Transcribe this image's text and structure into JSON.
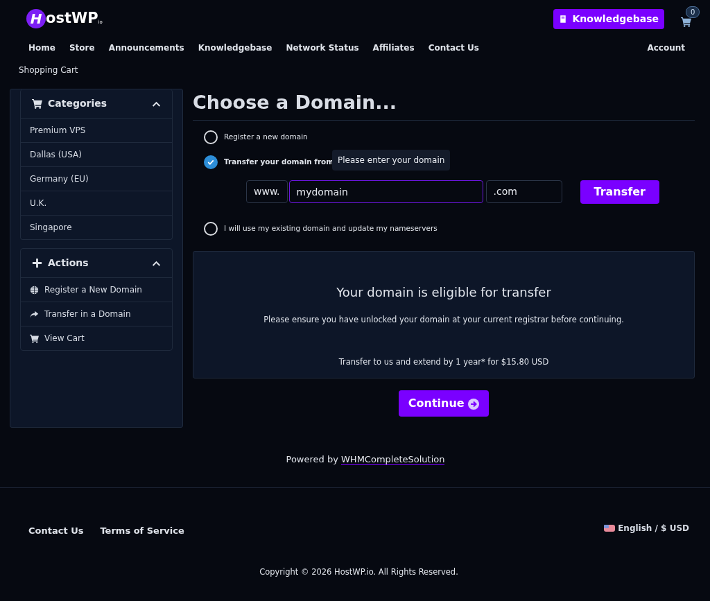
{
  "header": {
    "logo": {
      "mark": "H",
      "name": "ostWP",
      "suffix": "io"
    },
    "kb_button": "Knowledgebase",
    "cart_count": "0"
  },
  "nav": {
    "items": [
      "Home",
      "Store",
      "Announcements",
      "Knowledgebase",
      "Network Status",
      "Affiliates",
      "Contact Us"
    ],
    "account": "Account"
  },
  "breadcrumb": "Shopping Cart",
  "sidebar": [
    {
      "title": "Categories",
      "expanded": true,
      "items": [
        {
          "label": "Premium VPS"
        },
        {
          "label": "Dallas (USA)"
        },
        {
          "label": "Germany (EU)"
        },
        {
          "label": "U.K."
        },
        {
          "label": "Singapore"
        }
      ]
    },
    {
      "title": "Actions",
      "expanded": true,
      "items": [
        {
          "label": "Register a New Domain"
        },
        {
          "label": "Transfer in a Domain"
        },
        {
          "label": "View Cart"
        }
      ]
    }
  ],
  "main": {
    "title": "Choose a Domain...",
    "options": [
      {
        "label": "Register a new domain",
        "selected": false
      },
      {
        "label": "Transfer your domain from",
        "selected": true
      },
      {
        "label": "I will use my existing domain and update my nameservers",
        "selected": false
      }
    ],
    "prefix": "www.",
    "domain_value": "mydomain",
    "tooltip": "Please enter your domain",
    "tld": ".com",
    "transfer_button": "Transfer",
    "result": {
      "heading": "Your domain is eligible for transfer",
      "note": "Please ensure you have unlocked your domain at your current registrar before continuing.",
      "price": "Transfer to us and extend by 1 year* for $15.80 USD"
    },
    "continue_button": "Continue"
  },
  "powered": {
    "text": "Powered by",
    "link": "WHMCompleteSolution"
  },
  "footer": {
    "links": [
      "Contact Us",
      "Terms of Service"
    ],
    "locale": "English / $ USD",
    "copyright": "Copyright © 2026 HostWP.io. All Rights Reserved."
  }
}
